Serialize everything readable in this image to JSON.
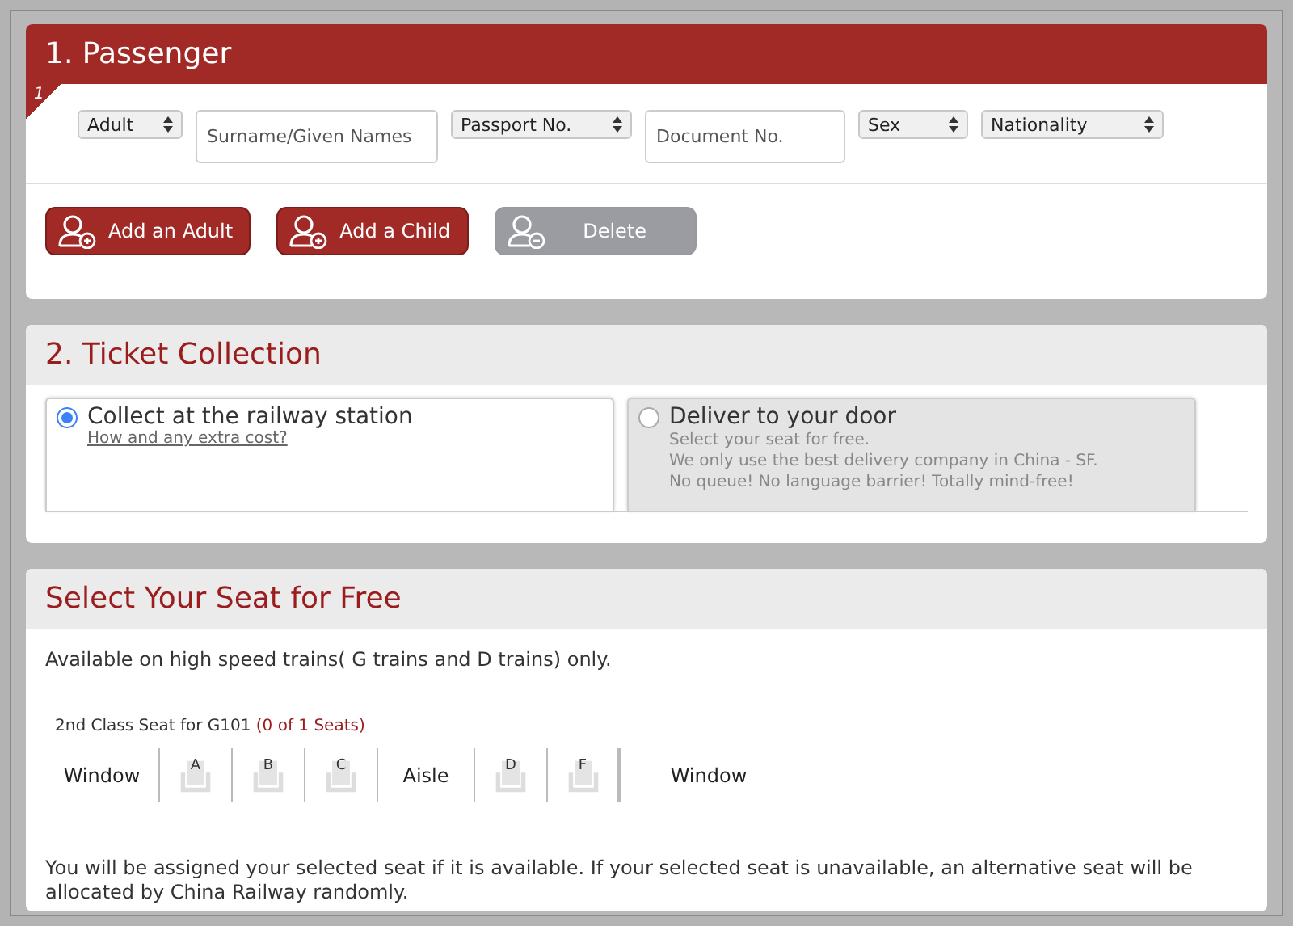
{
  "passenger": {
    "title": "1. Passenger",
    "row_number": "1",
    "fields": [
      {
        "kind": "select",
        "value": "Adult"
      },
      {
        "kind": "input",
        "placeholder": "Surname/Given Names"
      },
      {
        "kind": "select",
        "value": "Passport No."
      },
      {
        "kind": "input",
        "placeholder": "Document No."
      },
      {
        "kind": "select",
        "value": "Sex"
      },
      {
        "kind": "select",
        "value": "Nationality"
      }
    ],
    "buttons": [
      {
        "label": "Add an Adult",
        "kind": "add",
        "disabled": false
      },
      {
        "label": "Add a Child",
        "kind": "add",
        "disabled": false
      },
      {
        "label": "Delete",
        "kind": "remove",
        "disabled": true
      }
    ]
  },
  "ticket_collection": {
    "title": "2. Ticket Collection",
    "options": [
      {
        "label": "Collect at the railway station",
        "selected": true,
        "link": "How and any extra cost?"
      },
      {
        "label": "Deliver to your door",
        "selected": false,
        "lines": [
          "Select your seat for free.",
          "We only use the best delivery company in China - SF.",
          "No queue! No language barrier! Totally mind-free!"
        ]
      }
    ]
  },
  "seat_selection": {
    "title": "Select Your Seat for Free",
    "note": "Available on high speed trains( G trains and D trains) only.",
    "train_label": "2nd Class Seat for G101",
    "seat_count": "(0 of 1 Seats)",
    "seats": [
      {
        "kind": "label",
        "text": "Window"
      },
      {
        "kind": "seat",
        "text": "A",
        "selected": false
      },
      {
        "kind": "seat",
        "text": "B",
        "selected": false
      },
      {
        "kind": "seat",
        "text": "C",
        "selected": false
      },
      {
        "kind": "label",
        "text": "Aisle"
      },
      {
        "kind": "seat",
        "text": "D",
        "selected": false
      },
      {
        "kind": "seat",
        "text": "F",
        "selected": false
      },
      {
        "kind": "label",
        "text": "Window"
      }
    ],
    "footer": "You will be assigned your selected seat if it is available. If your selected seat is unavailable, an alternative seat will be allocated by China Railway randomly."
  }
}
